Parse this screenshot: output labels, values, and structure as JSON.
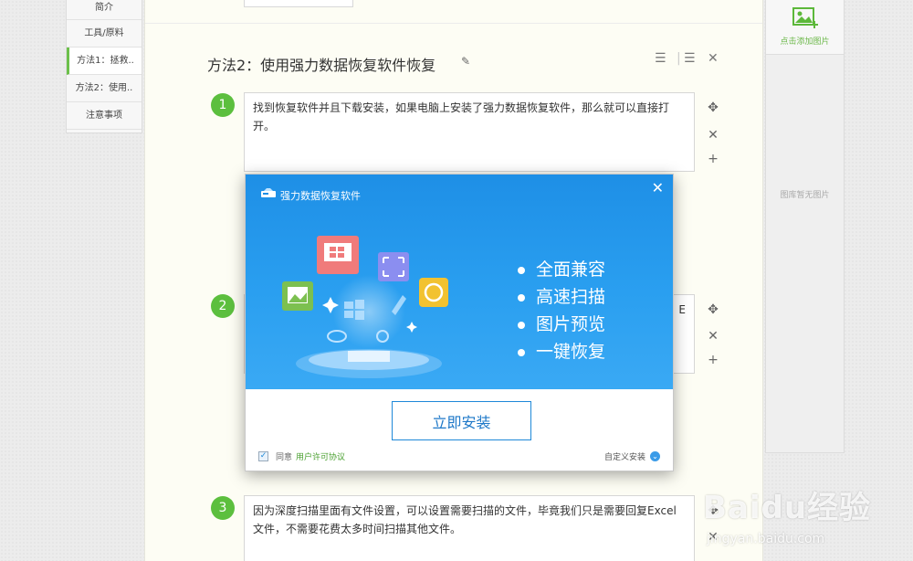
{
  "nav": {
    "items": [
      {
        "label": "简介"
      },
      {
        "label": "工具/原料"
      },
      {
        "label": "方法1：拯救.."
      },
      {
        "label": "方法2：使用.."
      },
      {
        "label": "注意事项"
      }
    ]
  },
  "section": {
    "title": "方法2：使用强力数据恢复软件恢复"
  },
  "steps": [
    {
      "num": "1",
      "text": "找到恢复软件并且下载安装，如果电脑上安装了强力数据恢复软件，那么就可以直接打开。"
    },
    {
      "num": "2",
      "text": "E"
    },
    {
      "num": "3",
      "text": "因为深度扫描里面有文件设置，可以设置需要扫描的文件，毕竟我们只是需要回复Excel文件，不需要花费太多时间扫描其他文件。"
    }
  ],
  "right_panel": {
    "add_image_label": "点击添加图片",
    "empty_label": "图库暂无图片"
  },
  "dialog": {
    "title": "强力数据恢复软件",
    "features": [
      "全面兼容",
      "高速扫描",
      "图片预览",
      "一键恢复"
    ],
    "install_button": "立即安装",
    "agree_label": "同意",
    "license_link": "用户许可协议",
    "custom_install": "自定义安装",
    "accent": "#1e8fe6"
  },
  "watermark": {
    "brand": "Baidu经验",
    "url": "jingyan.baidu.com"
  }
}
